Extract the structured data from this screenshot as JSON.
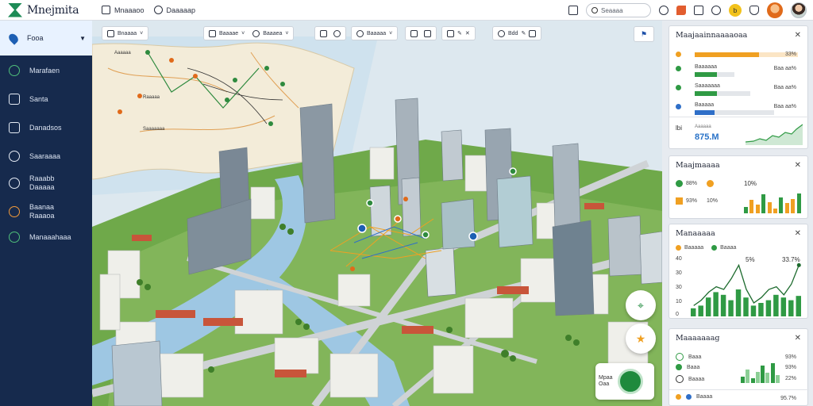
{
  "app": {
    "name": "Mnejmita"
  },
  "topbar": {
    "tab1_label": "Mnaaaoo",
    "tab2_label": "Daaaaap",
    "search_placeholder": "Seaaaa",
    "badge_value": "b"
  },
  "sidebar": {
    "active": {
      "label": "Fooa"
    },
    "items": [
      {
        "label": "Marafaen",
        "icon": "globe-icon"
      },
      {
        "label": "Santa",
        "icon": "layers-icon"
      },
      {
        "label": "Danadsos",
        "icon": "chart-icon"
      },
      {
        "label": "Saaraaaa",
        "icon": "route-icon"
      },
      {
        "label": "Raaabb",
        "label2": "Daaaaa",
        "icon": "pin-icon"
      },
      {
        "label": "Baanaa",
        "label2": "Raaaoa",
        "icon": "compass-icon"
      },
      {
        "label": "Manaaahaaa",
        "icon": "network-icon"
      }
    ]
  },
  "map_toolbar": {
    "group1": [
      "Bnaaaa"
    ],
    "group2": [
      "Baaaae",
      "Baaaea"
    ],
    "group3": [],
    "group4": [
      "Baaaaa"
    ],
    "group6": [
      "Bdd"
    ]
  },
  "map_labels": {
    "region_a": "Aaaaaa",
    "region_b": "Raaaaa",
    "region_c": "Saaaaaaa"
  },
  "minicard": {
    "line1": "Mpaa",
    "line2": "Oaa"
  },
  "panels": {
    "panel1": {
      "title": "Maajaainnaaaaoaa",
      "rows": [
        {
          "label": "",
          "value": "33%",
          "color": "#f0a022",
          "fraction": 0.62
        },
        {
          "label": "Baaaaaa",
          "value": "Baa aa%",
          "color": "#2f9a44",
          "fraction": 0.55
        },
        {
          "label": "Saaaaaaa",
          "value": "Baa aa%",
          "color": "#2f9a44",
          "fraction": 0.4
        },
        {
          "label": "Baaaaa",
          "value": "Baa aa%",
          "color": "#2f6fc8",
          "fraction": 0.25
        }
      ],
      "stat_label": "lbi",
      "stat_sub": "Aaaaaa",
      "stat_value": "875.M"
    },
    "panel2": {
      "title": "Maajmaaaa",
      "legend": [
        {
          "label": "93%",
          "color": "#2f9a44"
        },
        {
          "label": "11%",
          "color": "#f0a022"
        }
      ],
      "val_left_1": "88%",
      "val_left_2": "10%",
      "val_right": "10%",
      "bars": [
        0.3,
        0.6,
        0.4,
        0.85,
        0.5,
        0.2,
        0.7,
        0.45,
        0.65,
        0.9
      ]
    },
    "panel3": {
      "title": "Manaaaaa",
      "legend": [
        {
          "label": "Baaaaa",
          "color": "#f0a022"
        },
        {
          "label": "Baaaa",
          "color": "#2f9a44"
        }
      ],
      "top_values": [
        "5%",
        "33.7%"
      ],
      "y_ticks": [
        "40",
        "30",
        "30",
        "10",
        "0"
      ],
      "bars": [
        0.15,
        0.2,
        0.35,
        0.45,
        0.4,
        0.3,
        0.5,
        0.35,
        0.2,
        0.25,
        0.3,
        0.4,
        0.35,
        0.3,
        0.38
      ],
      "line": [
        0.2,
        0.3,
        0.45,
        0.55,
        0.5,
        0.7,
        0.95,
        0.5,
        0.25,
        0.35,
        0.5,
        0.55,
        0.4,
        0.6,
        0.95
      ]
    },
    "panel4": {
      "title": "Maaaaaaag",
      "rows": [
        {
          "label": "Baaa",
          "value": "93%"
        },
        {
          "label": "Baaa",
          "value": "93%"
        },
        {
          "label": "Baaaa",
          "value": "22%"
        }
      ],
      "bars": [
        0.3,
        0.6,
        0.2,
        0.5,
        0.8,
        0.45,
        0.9,
        0.35
      ],
      "footer_label": "Baaaa",
      "footer_value": "95.7%"
    }
  },
  "colors": {
    "sidebar_bg": "#162a4d",
    "accent_green": "#2f9a44",
    "accent_orange": "#f0a022",
    "accent_blue": "#2f6fc8"
  }
}
